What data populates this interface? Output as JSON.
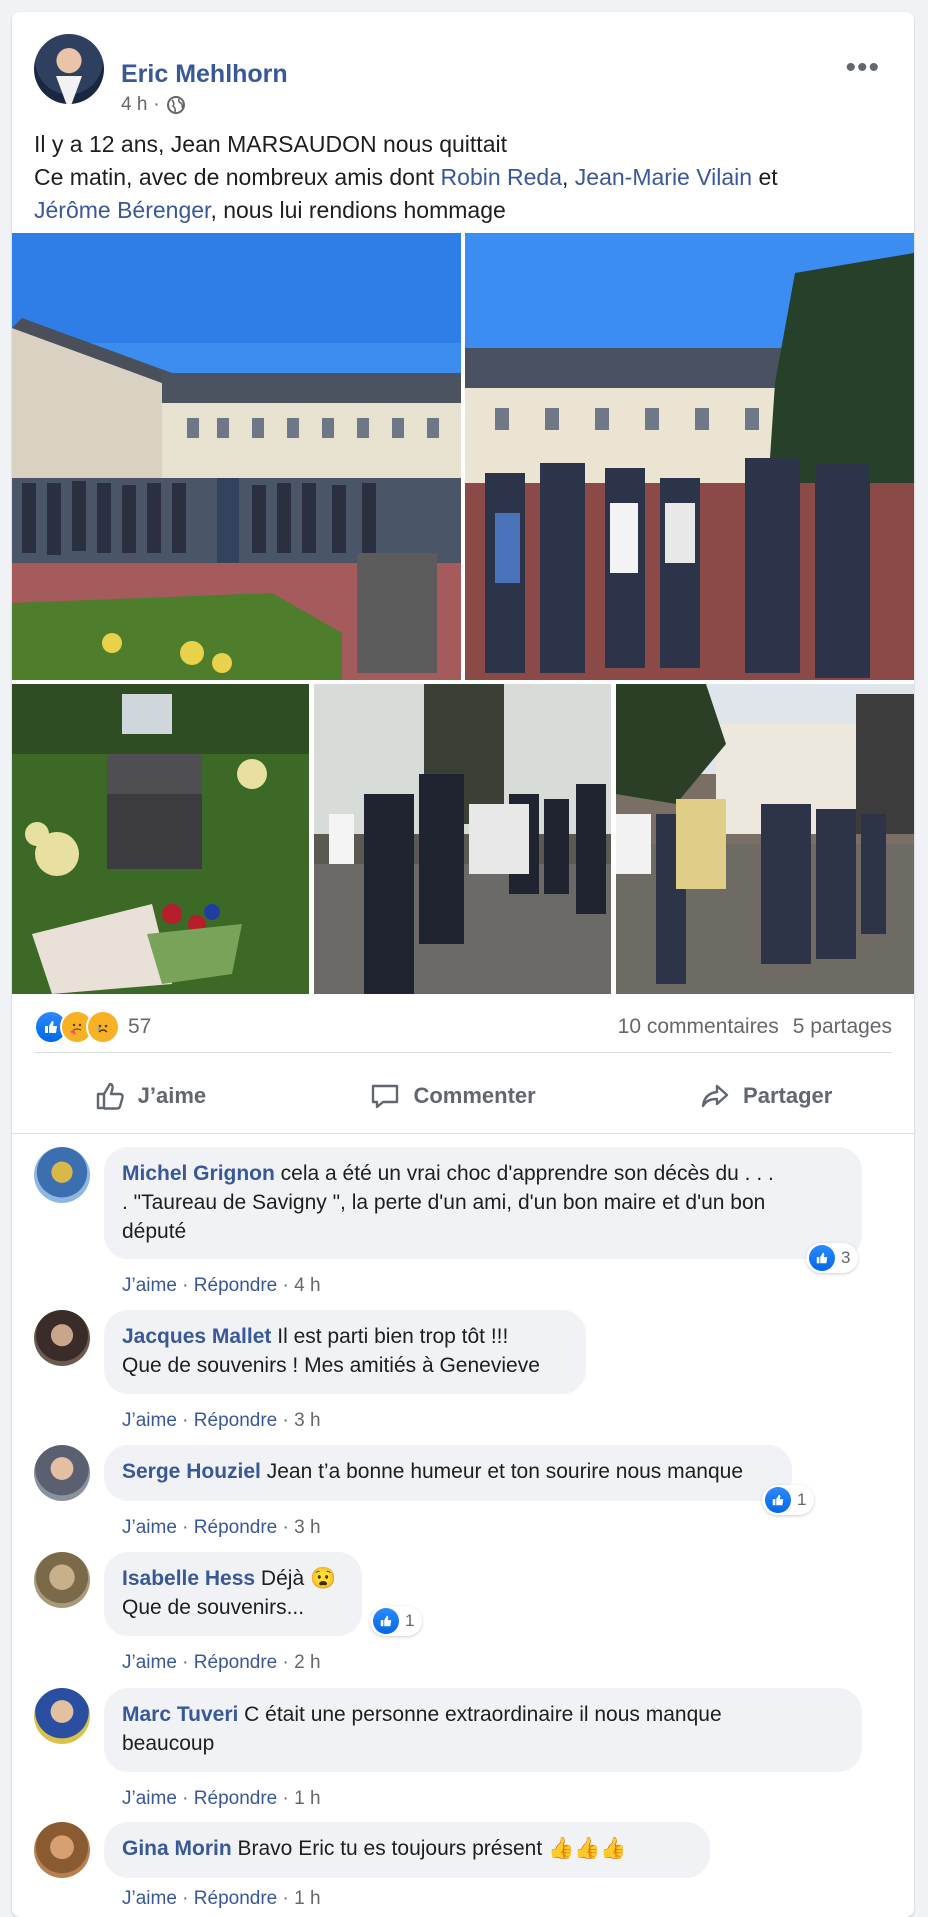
{
  "post": {
    "author": "Eric Mehlhorn",
    "time": "4 h",
    "meta_sep": "·",
    "text_line1": "Il y a 12 ans, Jean MARSAUDON nous quittait",
    "text_line2_a": "Ce matin, avec de nombreux amis dont ",
    "mention1": "Robin Reda",
    "sep1": ", ",
    "mention2": "Jean-Marie Vilain",
    "text_et": " et",
    "mention3": "Jérôme Bérenger",
    "text_end": ", nous lui rendions hommage",
    "more_label": "•••"
  },
  "reactions": {
    "count": "57",
    "comments": "10 commentaires",
    "shares": "5 partages"
  },
  "actions": {
    "like": "J’aime",
    "comment": "Commenter",
    "share": "Partager"
  },
  "comments": [
    {
      "name": "Michel Grignon",
      "text": " cela a été un vrai choc d'apprendre son décès du . . .",
      "text2": ". \"Taureau de Savigny \", la perte d'un ami, d'un bon maire et d'un bon",
      "text3": "député",
      "like": "J’aime",
      "reply": "Répondre",
      "time": "4 h",
      "reaction_count": "3"
    },
    {
      "name": "Jacques Mallet",
      "text": " Il est parti bien trop tôt !!!",
      "text2": "Que de souvenirs ! Mes amitiés à Genevieve",
      "like": "J’aime",
      "reply": "Répondre",
      "time": "3 h"
    },
    {
      "name": "Serge Houziel",
      "text": " Jean t’a bonne humeur et ton sourire nous manque",
      "like": "J’aime",
      "reply": "Répondre",
      "time": "3 h",
      "reaction_count": "1"
    },
    {
      "name": "Isabelle Hess",
      "text": " Déjà 😧",
      "text2": "Que de souvenirs...",
      "like": "J’aime",
      "reply": "Répondre",
      "time": "2 h",
      "reaction_count": "1"
    },
    {
      "name": "Marc Tuveri",
      "text": " C était une personne extraordinaire il nous manque",
      "text2": "beaucoup",
      "like": "J’aime",
      "reply": "Répondre",
      "time": "1 h"
    },
    {
      "name": "Gina Morin",
      "text": " Bravo Eric tu es toujours présent 👍👍👍",
      "like": "J’aime",
      "reply": "Répondre",
      "time": "1 h"
    }
  ],
  "colors": {
    "link_blue": "#385898",
    "like_blue": "#1877f2",
    "secondary": "#65676b"
  }
}
